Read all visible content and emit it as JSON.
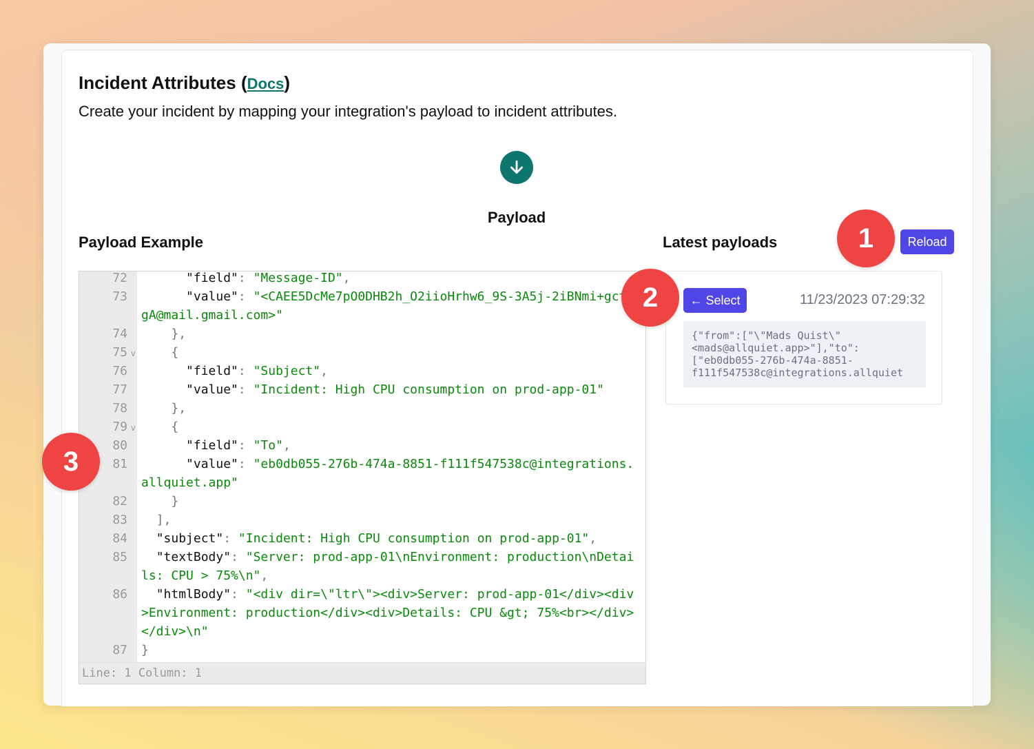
{
  "header": {
    "title": "Incident Attributes",
    "docs_link": "Docs",
    "subtitle": "Create your incident by mapping your integration's payload to incident attributes."
  },
  "payload_section": {
    "title": "Payload",
    "example_title": "Payload Example",
    "latest_title": "Latest payloads",
    "reload_label": "Reload"
  },
  "editor": {
    "lines": [
      {
        "n": "72",
        "text": "      \"field\": \"Message-ID\","
      },
      {
        "n": "73",
        "text": "      \"value\": \"<CAEE5DcMe7pO0DHB2h_O2iioHrhw6_9S-3A5j-2iBNmi+gctEgA@mail.gmail.com>\""
      },
      {
        "n": "74",
        "text": "    },"
      },
      {
        "n": "75",
        "text": "    {",
        "fold": true
      },
      {
        "n": "76",
        "text": "      \"field\": \"Subject\","
      },
      {
        "n": "77",
        "text": "      \"value\": \"Incident: High CPU consumption on prod-app-01\""
      },
      {
        "n": "78",
        "text": "    },"
      },
      {
        "n": "79",
        "text": "    {",
        "fold": true
      },
      {
        "n": "80",
        "text": "      \"field\": \"To\","
      },
      {
        "n": "81",
        "text": "      \"value\": \"eb0db055-276b-474a-8851-f111f547538c@integrations.allquiet.app\""
      },
      {
        "n": "82",
        "text": "    }"
      },
      {
        "n": "83",
        "text": "  ],"
      },
      {
        "n": "84",
        "text": "  \"subject\": \"Incident: High CPU consumption on prod-app-01\","
      },
      {
        "n": "85",
        "text": "  \"textBody\": \"Server: prod-app-01\\nEnvironment: production\\nDetails: CPU > 75%\\n\","
      },
      {
        "n": "86",
        "text": "  \"htmlBody\": \"<div dir=\\\"ltr\\\"><div>Server: prod-app-01</div><div>Environment: production</div><div>Details: CPU &gt; 75%<br></div></div>\\n\""
      },
      {
        "n": "87",
        "text": "}"
      }
    ],
    "status": "Line: 1  Column: 1"
  },
  "latest_payload": {
    "select_label": "← Select",
    "timestamp": "11/23/2023 07:29:32",
    "preview": "{\"from\":[\"\\\"Mads Quist\\\"\n<mads@allquiet.app>\"],\"to\":\n[\"eb0db055-276b-474a-8851-\nf111f547538c@integrations.allquiet"
  },
  "badges": [
    "1",
    "2",
    "3"
  ],
  "colors": {
    "accent": "#4f46e5",
    "teal": "#0f766e",
    "badge": "#ef4444",
    "string": "#0a8a0a"
  },
  "icons": {
    "down_arrow": "arrow-down-circle-icon"
  }
}
